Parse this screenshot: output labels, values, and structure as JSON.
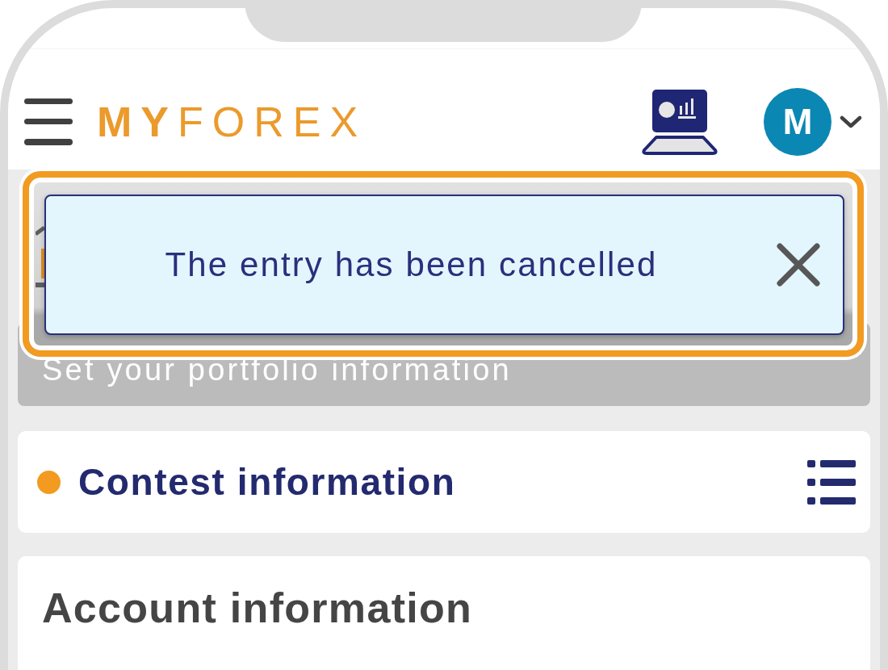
{
  "header": {
    "logo": "**MY**FOREX",
    "avatar_initial": "M"
  },
  "notification": {
    "message": "The entry has been cancelled",
    "highlighted": true
  },
  "portfolio_bar": {
    "text": "Set your portfolio information"
  },
  "sections": [
    {
      "kind": "menu",
      "title": "Contest information"
    },
    {
      "kind": "heading",
      "title": "Account information"
    }
  ]
}
